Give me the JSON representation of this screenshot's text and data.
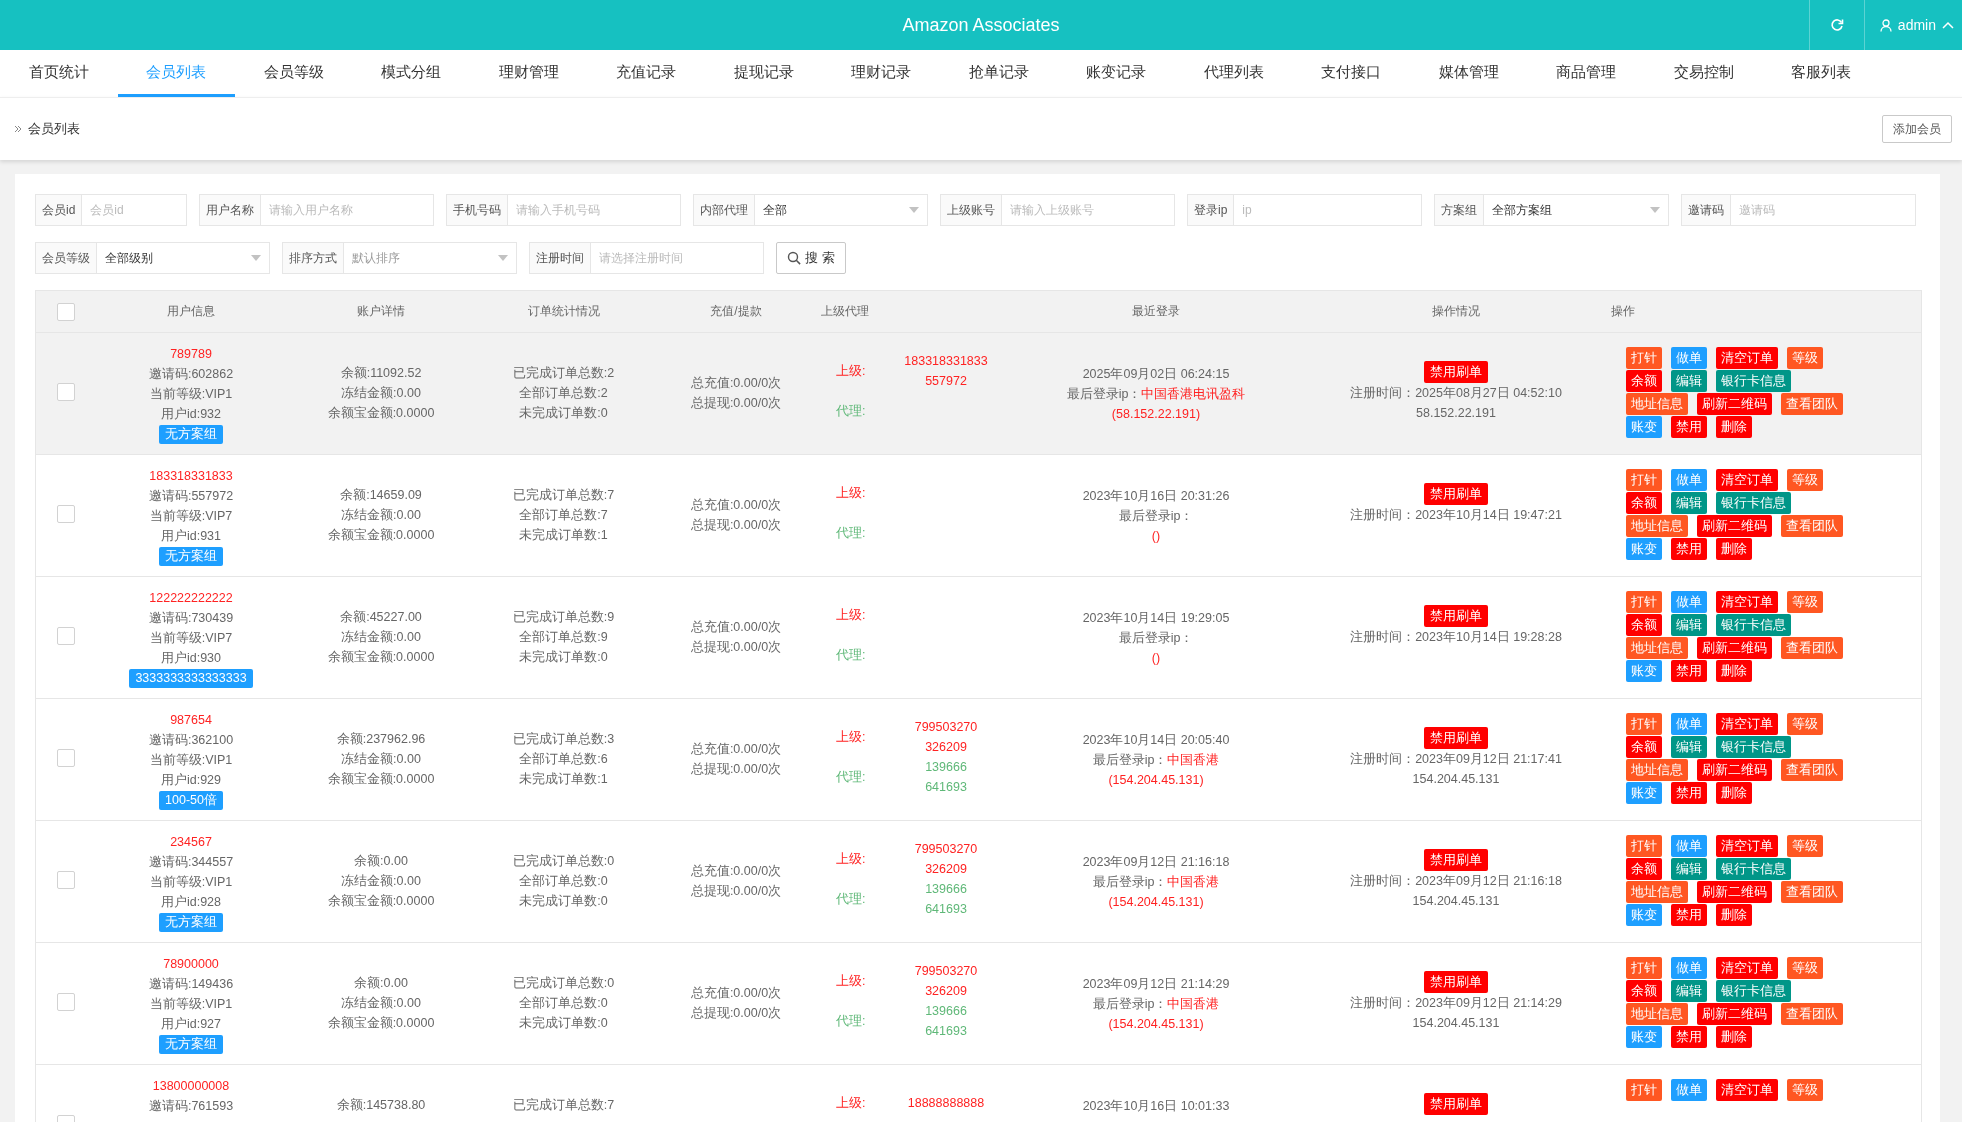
{
  "header": {
    "title": "Amazon Associates",
    "user": "admin"
  },
  "nav": [
    {
      "label": "首页统计",
      "selected": false
    },
    {
      "label": "会员列表",
      "selected": true
    },
    {
      "label": "会员等级",
      "selected": false
    },
    {
      "label": "模式分组",
      "selected": false
    },
    {
      "label": "理财管理",
      "selected": false
    },
    {
      "label": "充值记录",
      "selected": false
    },
    {
      "label": "提现记录",
      "selected": false
    },
    {
      "label": "理财记录",
      "selected": false
    },
    {
      "label": "抢单记录",
      "selected": false
    },
    {
      "label": "账变记录",
      "selected": false
    },
    {
      "label": "代理列表",
      "selected": false
    },
    {
      "label": "支付接口",
      "selected": false
    },
    {
      "label": "媒体管理",
      "selected": false
    },
    {
      "label": "商品管理",
      "selected": false
    },
    {
      "label": "交易控制",
      "selected": false
    },
    {
      "label": "客服列表",
      "selected": false
    }
  ],
  "breadcrumb": "会员列表",
  "add_button": "添加会员",
  "filters": [
    [
      {
        "label": "会员id",
        "kind": "input",
        "placeholder": "会员id"
      },
      {
        "label": "用户名称",
        "kind": "input",
        "placeholder": "请输入用户名称"
      },
      {
        "label": "手机号码",
        "kind": "input",
        "placeholder": "请输入手机号码"
      },
      {
        "label": "内部代理",
        "kind": "select",
        "value": "全部"
      },
      {
        "label": "上级账号",
        "kind": "input",
        "placeholder": "请输入上级账号"
      },
      {
        "label": "登录ip",
        "kind": "input",
        "placeholder": "ip"
      },
      {
        "label": "方案组",
        "kind": "select",
        "value": "全部方案组"
      },
      {
        "label": "邀请码",
        "kind": "input",
        "placeholder": "邀请码"
      }
    ],
    [
      {
        "label": "会员等级",
        "kind": "select",
        "value": "全部级别"
      },
      {
        "label": "排序方式",
        "kind": "select",
        "placeholder": "默认排序"
      },
      {
        "label": "注册时间",
        "kind": "input",
        "placeholder": "请选择注册时间"
      }
    ]
  ],
  "search_button": "搜 索",
  "table": {
    "select_all": false,
    "columns": [
      "用户信息",
      "账户详情",
      "订单统计情况",
      "充值/提款",
      "上级代理",
      "最近登录",
      "操作情况",
      "操作"
    ],
    "rows": [
      {
        "selected": false,
        "highlighted": true,
        "username": "789789",
        "info": [
          "邀请码:602862",
          "当前等级:VIP1",
          "用户id:932"
        ],
        "group": "无方案组",
        "account": [
          "余额:11092.52",
          "冻结金额:0.00",
          "余额宝金额:0.0000"
        ],
        "orders": [
          "已完成订单总数:2",
          "全部订单总数:2",
          "未完成订单数:0"
        ],
        "funds": [
          "总充值:0.00/0次",
          "总提现:0.00/0次"
        ],
        "upline_label": "上级:",
        "upline": [
          "183318331833",
          "557972"
        ],
        "agent_label": "代理:",
        "agents": [],
        "login_time": "2025年09月02日 06:24:15",
        "login_ip_label": "最后登录ip：",
        "login_location": "中国香港电讯盈科",
        "login_ip": "(58.152.22.191)",
        "ban_button": "禁用刷单",
        "reg_time": "注册时间：2025年08月27日 04:52:10",
        "reg_ip": "58.152.22.191",
        "actions": [
          [
            {
              "label": "打针",
              "color": "#ff5722"
            },
            {
              "label": "做单",
              "color": "#1e9fff"
            },
            {
              "label": "清空订单",
              "color": "#ff0000"
            },
            {
              "label": "等级",
              "color": "#ff5722"
            }
          ],
          [
            {
              "label": "余额",
              "color": "#ff0000"
            },
            {
              "label": "编辑",
              "color": "#009688"
            },
            {
              "label": "银行卡信息",
              "color": "#009688"
            }
          ],
          [
            {
              "label": "地址信息",
              "color": "#ff5722"
            },
            {
              "label": "刷新二维码",
              "color": "#ff0000"
            },
            {
              "label": "查看团队",
              "color": "#ff5722"
            }
          ],
          [
            {
              "label": "账变",
              "color": "#1e9fff"
            },
            {
              "label": "禁用",
              "color": "#ff0000"
            },
            {
              "label": "删除",
              "color": "#ff0000"
            }
          ]
        ]
      },
      {
        "selected": false,
        "highlighted": false,
        "username": "183318331833",
        "info": [
          "邀请码:557972",
          "当前等级:VIP7",
          "用户id:931"
        ],
        "group": "无方案组",
        "account": [
          "余额:14659.09",
          "冻结金额:0.00",
          "余额宝金额:0.0000"
        ],
        "orders": [
          "已完成订单总数:7",
          "全部订单总数:7",
          "未完成订单数:1"
        ],
        "funds": [
          "总充值:0.00/0次",
          "总提现:0.00/0次"
        ],
        "upline_label": "上级:",
        "upline": [],
        "agent_label": "代理:",
        "agents": [],
        "login_time": "2023年10月16日 20:31:26",
        "login_ip_label": "最后登录ip：",
        "login_ip": "()",
        "ban_button": "禁用刷单",
        "reg_time": "注册时间：2023年10月14日 19:47:21",
        "actions": [
          [
            {
              "label": "打针",
              "color": "#ff5722"
            },
            {
              "label": "做单",
              "color": "#1e9fff"
            },
            {
              "label": "清空订单",
              "color": "#ff0000"
            },
            {
              "label": "等级",
              "color": "#ff5722"
            }
          ],
          [
            {
              "label": "余额",
              "color": "#ff0000"
            },
            {
              "label": "编辑",
              "color": "#009688"
            },
            {
              "label": "银行卡信息",
              "color": "#009688"
            }
          ],
          [
            {
              "label": "地址信息",
              "color": "#ff5722"
            },
            {
              "label": "刷新二维码",
              "color": "#ff0000"
            },
            {
              "label": "查看团队",
              "color": "#ff5722"
            }
          ],
          [
            {
              "label": "账变",
              "color": "#1e9fff"
            },
            {
              "label": "禁用",
              "color": "#ff0000"
            },
            {
              "label": "删除",
              "color": "#ff0000"
            }
          ]
        ]
      },
      {
        "selected": false,
        "highlighted": false,
        "username": "122222222222",
        "info": [
          "邀请码:730439",
          "当前等级:VIP7",
          "用户id:930"
        ],
        "group": "3333333333333333",
        "account": [
          "余额:45227.00",
          "冻结金额:0.00",
          "余额宝金额:0.0000"
        ],
        "orders": [
          "已完成订单总数:9",
          "全部订单总数:9",
          "未完成订单数:0"
        ],
        "funds": [
          "总充值:0.00/0次",
          "总提现:0.00/0次"
        ],
        "upline_label": "上级:",
        "upline": [],
        "agent_label": "代理:",
        "agents": [],
        "login_time": "2023年10月14日 19:29:05",
        "login_ip_label": "最后登录ip：",
        "login_ip": "()",
        "ban_button": "禁用刷单",
        "reg_time": "注册时间：2023年10月14日 19:28:28",
        "actions": [
          [
            {
              "label": "打针",
              "color": "#ff5722"
            },
            {
              "label": "做单",
              "color": "#1e9fff"
            },
            {
              "label": "清空订单",
              "color": "#ff0000"
            },
            {
              "label": "等级",
              "color": "#ff5722"
            }
          ],
          [
            {
              "label": "余额",
              "color": "#ff0000"
            },
            {
              "label": "编辑",
              "color": "#009688"
            },
            {
              "label": "银行卡信息",
              "color": "#009688"
            }
          ],
          [
            {
              "label": "地址信息",
              "color": "#ff5722"
            },
            {
              "label": "刷新二维码",
              "color": "#ff0000"
            },
            {
              "label": "查看团队",
              "color": "#ff5722"
            }
          ],
          [
            {
              "label": "账变",
              "color": "#1e9fff"
            },
            {
              "label": "禁用",
              "color": "#ff0000"
            },
            {
              "label": "删除",
              "color": "#ff0000"
            }
          ]
        ]
      },
      {
        "selected": false,
        "highlighted": false,
        "username": "987654",
        "info": [
          "邀请码:362100",
          "当前等级:VIP1",
          "用户id:929"
        ],
        "group": "100-50倍",
        "account": [
          "余额:237962.96",
          "冻结金额:0.00",
          "余额宝金额:0.0000"
        ],
        "orders": [
          "已完成订单总数:3",
          "全部订单总数:6",
          "未完成订单数:1"
        ],
        "funds": [
          "总充值:0.00/0次",
          "总提现:0.00/0次"
        ],
        "upline_label": "上级:",
        "upline": [
          "799503270",
          "326209"
        ],
        "agent_label": "代理:",
        "agents": [
          "139666",
          "641693"
        ],
        "login_time": "2023年10月14日 20:05:40",
        "login_ip_label": "最后登录ip：",
        "login_location": "中国香港",
        "login_ip": "(154.204.45.131)",
        "ban_button": "禁用刷单",
        "reg_time": "注册时间：2023年09月12日 21:17:41",
        "reg_ip": "154.204.45.131",
        "actions": [
          [
            {
              "label": "打针",
              "color": "#ff5722"
            },
            {
              "label": "做单",
              "color": "#1e9fff"
            },
            {
              "label": "清空订单",
              "color": "#ff0000"
            },
            {
              "label": "等级",
              "color": "#ff5722"
            }
          ],
          [
            {
              "label": "余额",
              "color": "#ff0000"
            },
            {
              "label": "编辑",
              "color": "#009688"
            },
            {
              "label": "银行卡信息",
              "color": "#009688"
            }
          ],
          [
            {
              "label": "地址信息",
              "color": "#ff5722"
            },
            {
              "label": "刷新二维码",
              "color": "#ff0000"
            },
            {
              "label": "查看团队",
              "color": "#ff5722"
            }
          ],
          [
            {
              "label": "账变",
              "color": "#1e9fff"
            },
            {
              "label": "禁用",
              "color": "#ff0000"
            },
            {
              "label": "删除",
              "color": "#ff0000"
            }
          ]
        ]
      },
      {
        "selected": false,
        "highlighted": false,
        "username": "234567",
        "info": [
          "邀请码:344557",
          "当前等级:VIP1",
          "用户id:928"
        ],
        "group": "无方案组",
        "account": [
          "余额:0.00",
          "冻结金额:0.00",
          "余额宝金额:0.0000"
        ],
        "orders": [
          "已完成订单总数:0",
          "全部订单总数:0",
          "未完成订单数:0"
        ],
        "funds": [
          "总充值:0.00/0次",
          "总提现:0.00/0次"
        ],
        "upline_label": "上级:",
        "upline": [
          "799503270",
          "326209"
        ],
        "agent_label": "代理:",
        "agents": [
          "139666",
          "641693"
        ],
        "login_time": "2023年09月12日 21:16:18",
        "login_ip_label": "最后登录ip：",
        "login_location": "中国香港",
        "login_ip": "(154.204.45.131)",
        "ban_button": "禁用刷单",
        "reg_time": "注册时间：2023年09月12日 21:16:18",
        "reg_ip": "154.204.45.131",
        "actions": [
          [
            {
              "label": "打针",
              "color": "#ff5722"
            },
            {
              "label": "做单",
              "color": "#1e9fff"
            },
            {
              "label": "清空订单",
              "color": "#ff0000"
            },
            {
              "label": "等级",
              "color": "#ff5722"
            }
          ],
          [
            {
              "label": "余额",
              "color": "#ff0000"
            },
            {
              "label": "编辑",
              "color": "#009688"
            },
            {
              "label": "银行卡信息",
              "color": "#009688"
            }
          ],
          [
            {
              "label": "地址信息",
              "color": "#ff5722"
            },
            {
              "label": "刷新二维码",
              "color": "#ff0000"
            },
            {
              "label": "查看团队",
              "color": "#ff5722"
            }
          ],
          [
            {
              "label": "账变",
              "color": "#1e9fff"
            },
            {
              "label": "禁用",
              "color": "#ff0000"
            },
            {
              "label": "删除",
              "color": "#ff0000"
            }
          ]
        ]
      },
      {
        "selected": false,
        "highlighted": false,
        "username": "78900000",
        "info": [
          "邀请码:149436",
          "当前等级:VIP1",
          "用户id:927"
        ],
        "group": "无方案组",
        "account": [
          "余额:0.00",
          "冻结金额:0.00",
          "余额宝金额:0.0000"
        ],
        "orders": [
          "已完成订单总数:0",
          "全部订单总数:0",
          "未完成订单数:0"
        ],
        "funds": [
          "总充值:0.00/0次",
          "总提现:0.00/0次"
        ],
        "upline_label": "上级:",
        "upline": [
          "799503270",
          "326209"
        ],
        "agent_label": "代理:",
        "agents": [
          "139666",
          "641693"
        ],
        "login_time": "2023年09月12日 21:14:29",
        "login_ip_label": "最后登录ip：",
        "login_location": "中国香港",
        "login_ip": "(154.204.45.131)",
        "ban_button": "禁用刷单",
        "reg_time": "注册时间：2023年09月12日 21:14:29",
        "reg_ip": "154.204.45.131",
        "actions": [
          [
            {
              "label": "打针",
              "color": "#ff5722"
            },
            {
              "label": "做单",
              "color": "#1e9fff"
            },
            {
              "label": "清空订单",
              "color": "#ff0000"
            },
            {
              "label": "等级",
              "color": "#ff5722"
            }
          ],
          [
            {
              "label": "余额",
              "color": "#ff0000"
            },
            {
              "label": "编辑",
              "color": "#009688"
            },
            {
              "label": "银行卡信息",
              "color": "#009688"
            }
          ],
          [
            {
              "label": "地址信息",
              "color": "#ff5722"
            },
            {
              "label": "刷新二维码",
              "color": "#ff0000"
            },
            {
              "label": "查看团队",
              "color": "#ff5722"
            }
          ],
          [
            {
              "label": "账变",
              "color": "#1e9fff"
            },
            {
              "label": "禁用",
              "color": "#ff0000"
            },
            {
              "label": "删除",
              "color": "#ff0000"
            }
          ]
        ]
      },
      {
        "selected": false,
        "highlighted": false,
        "username": "13800000008",
        "info": [
          "邀请码:761593"
        ],
        "account": [
          "余额:145738.80"
        ],
        "orders": [
          "已完成订单总数:7"
        ],
        "upline_label": "上级:",
        "upline": [
          "18888888888"
        ],
        "login_time": "2023年10月16日 10:01:33",
        "ban_button": "禁用刷单",
        "actions": [
          [
            {
              "label": "打针",
              "color": "#ff5722"
            },
            {
              "label": "做单",
              "color": "#1e9fff"
            },
            {
              "label": "清空订单",
              "color": "#ff0000"
            },
            {
              "label": "等级",
              "color": "#ff5722"
            }
          ]
        ]
      }
    ]
  }
}
